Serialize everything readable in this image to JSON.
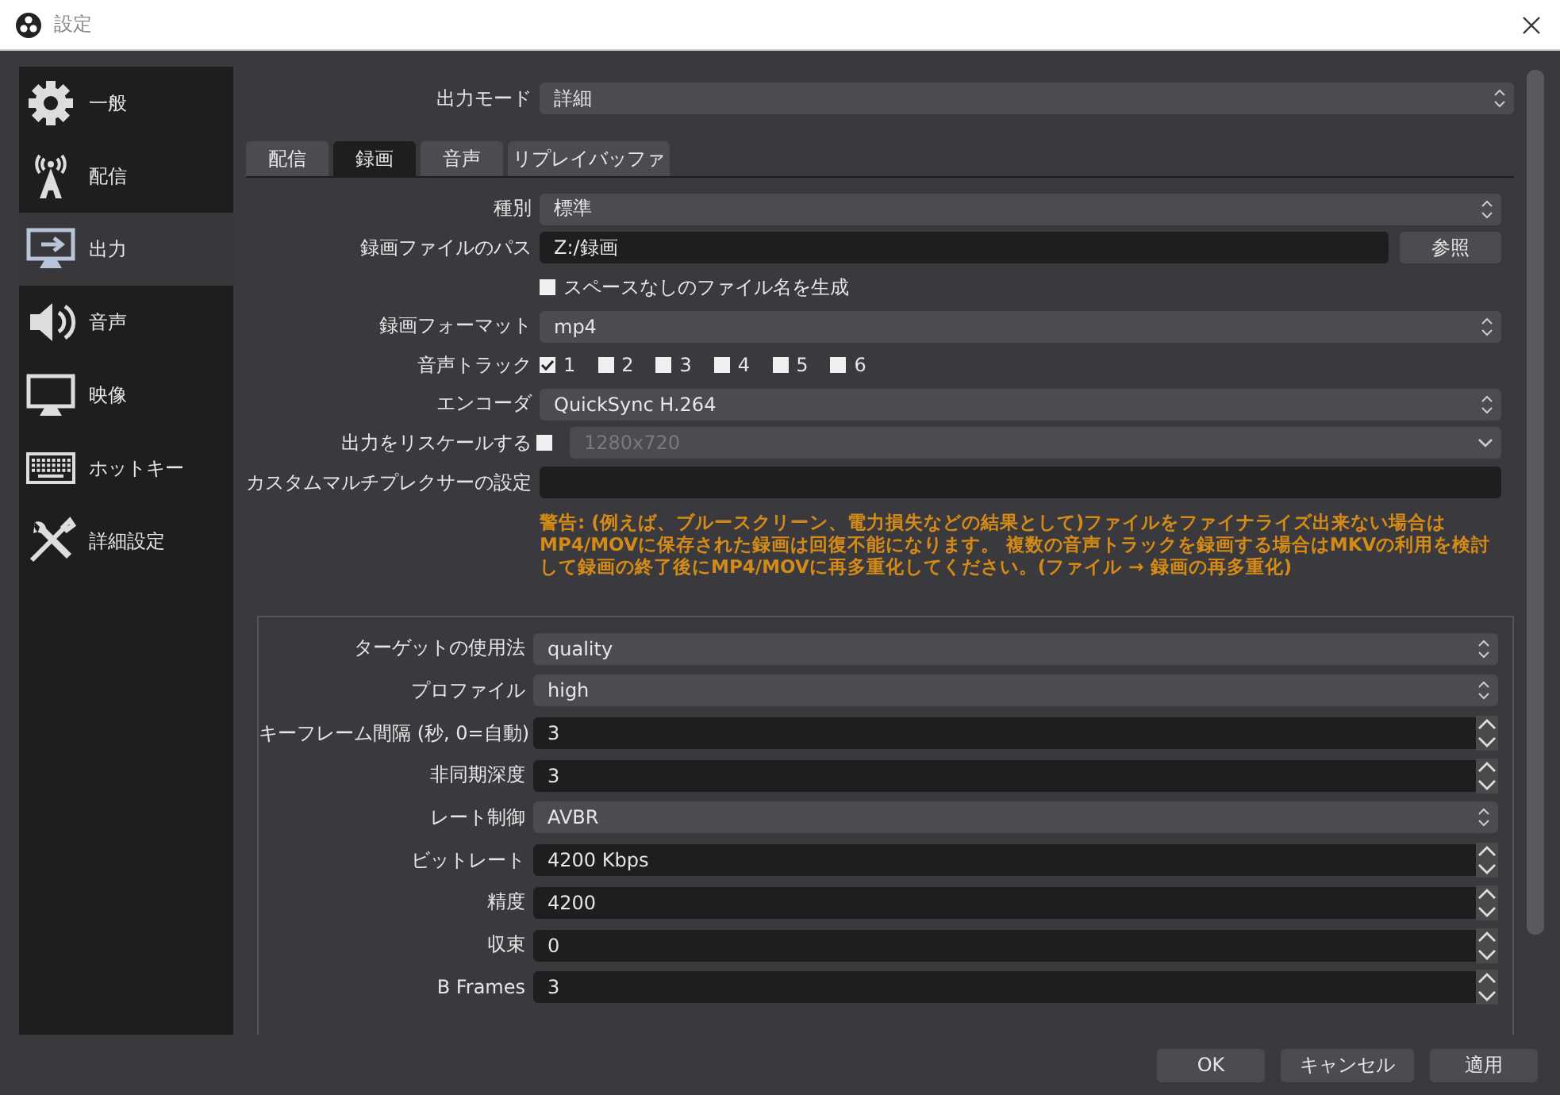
{
  "window": {
    "title": "設定"
  },
  "sidebar": {
    "items": [
      {
        "label": "一般",
        "selected": false
      },
      {
        "label": "配信",
        "selected": false
      },
      {
        "label": "出力",
        "selected": true
      },
      {
        "label": "音声",
        "selected": false
      },
      {
        "label": "映像",
        "selected": false
      },
      {
        "label": "ホットキー",
        "selected": false
      },
      {
        "label": "詳細設定",
        "selected": false
      }
    ]
  },
  "output_mode": {
    "label": "出力モード",
    "value": "詳細"
  },
  "tabs": [
    {
      "label": "配信",
      "selected": false
    },
    {
      "label": "録画",
      "selected": true
    },
    {
      "label": "音声",
      "selected": false
    },
    {
      "label": "リプレイバッファ",
      "selected": false
    }
  ],
  "recording_form": [
    {
      "kind": "select",
      "label": "種別",
      "value": "標準"
    },
    {
      "kind": "path",
      "label": "録画ファイルのパス",
      "value": "Z:/録画",
      "button": "参照"
    },
    {
      "kind": "checkbox",
      "label": "スペースなしのファイル名を生成",
      "checked": false
    },
    {
      "kind": "select",
      "label": "録画フォーマット",
      "value": "mp4"
    },
    {
      "kind": "tracks",
      "label": "音声トラック",
      "tracks": [
        {
          "label": "1",
          "checked": true
        },
        {
          "label": "2",
          "checked": false
        },
        {
          "label": "3",
          "checked": false
        },
        {
          "label": "4",
          "checked": false
        },
        {
          "label": "5",
          "checked": false
        },
        {
          "label": "6",
          "checked": false
        }
      ]
    },
    {
      "kind": "select",
      "label": "エンコーダ",
      "value": "QuickSync H.264"
    },
    {
      "kind": "rescale",
      "label": "出力をリスケールする",
      "checked": false,
      "value": "1280x720",
      "disabled": true
    },
    {
      "kind": "text",
      "label": "カスタムマルチプレクサーの設定"
    }
  ],
  "warning": "警告: (例えば、ブルースクリーン、電力損失などの結果として)ファイルをファイナライズ出来ない場合はMP4/MOVに保存された録画は回復不能になります。 複数の音声トラックを録画する場合はMKVの利用を検討して録画の終了後にMP4/MOVに再多重化してください。(ファイル → 録画の再多重化)",
  "encoder_settings": [
    {
      "kind": "select",
      "label": "ターゲットの使用法",
      "value": "quality"
    },
    {
      "kind": "select",
      "label": "プロファイル",
      "value": "high"
    },
    {
      "kind": "spin",
      "label": "キーフレーム間隔 (秒, 0=自動)",
      "value": "3"
    },
    {
      "kind": "spin",
      "label": "非同期深度",
      "value": "3"
    },
    {
      "kind": "select",
      "label": "レート制御",
      "value": "AVBR"
    },
    {
      "kind": "spin",
      "label": "ビットレート",
      "value": "4200 Kbps"
    },
    {
      "kind": "spin",
      "label": "精度",
      "value": "4200"
    },
    {
      "kind": "spin",
      "label": "収束",
      "value": "0"
    },
    {
      "kind": "spin",
      "label": "B Frames",
      "value": "3"
    }
  ],
  "buttons": [
    "OK",
    "キャンセル",
    "適用"
  ]
}
